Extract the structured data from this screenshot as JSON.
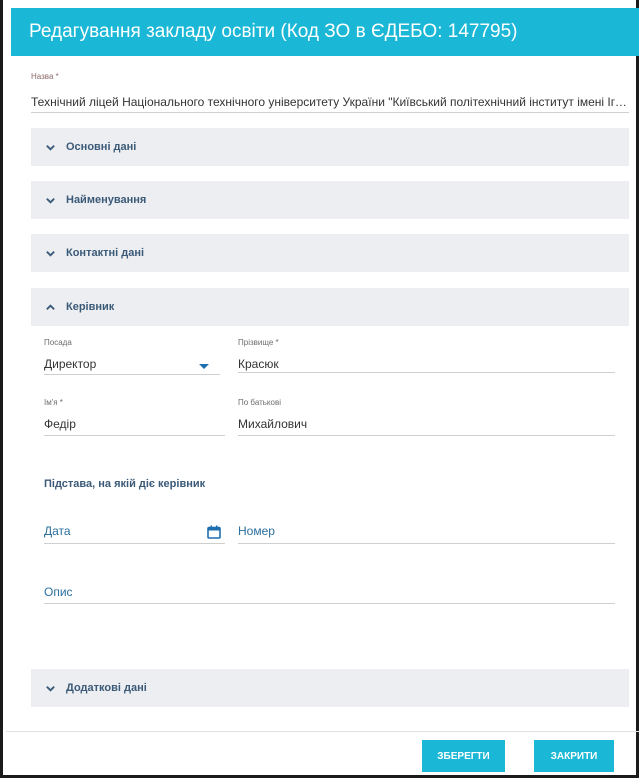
{
  "dialog": {
    "title": "Редагування закладу освіти (Код ЗО в ЄДЕБО: 147795)"
  },
  "name_field": {
    "label": "Назва *",
    "value": "Технічний ліцей Національного технічного університету України \"Київський політехнічний інститут імені Ігоря Сікорського\""
  },
  "sections": {
    "main": "Основні дані",
    "naming": "Найменування",
    "contacts": "Контактні дані",
    "head": "Керівник",
    "additional": "Додаткові дані"
  },
  "head": {
    "position_label": "Посада",
    "position_value": "Директор",
    "surname_label": "Прізвище *",
    "surname_value": "Красюк",
    "firstname_label": "Ім'я *",
    "firstname_value": "Федір",
    "patronymic_label": "По батькові",
    "patronymic_value": "Михайлович",
    "basis_heading": "Підстава, на якій діє керівник",
    "date_placeholder": "Дата",
    "number_placeholder": "Номер",
    "description_placeholder": "Опис"
  },
  "buttons": {
    "save": "ЗБЕРЕГТИ",
    "close": "ЗАКРИТИ"
  },
  "colors": {
    "accent": "#1ab8d6",
    "section_bg": "#eceef1",
    "section_text": "#3b5a78"
  },
  "icons": {
    "collapsed": "chevron-down-icon",
    "expanded": "chevron-up-icon",
    "calendar": "calendar-icon",
    "dropdown": "caret-down-icon"
  }
}
